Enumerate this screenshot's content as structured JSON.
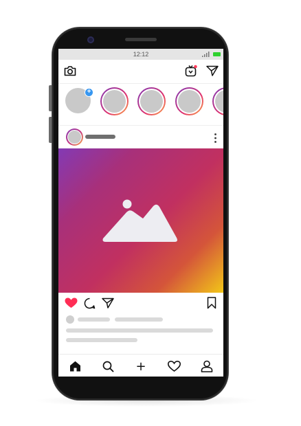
{
  "status_bar": {
    "time": "12:12",
    "battery_color": "#2fd12f"
  },
  "top_bar": {
    "left_icon": "camera-icon",
    "right_icons": [
      "igtv-icon",
      "direct-message-icon"
    ],
    "notification_color": "#ff3b5c"
  },
  "stories": {
    "own_story_add_glyph": "+",
    "add_badge_color": "#3897f0",
    "ring_gradient": [
      "#833ab4",
      "#c13584",
      "#e1306c",
      "#fcb045"
    ],
    "story_count_visible": 4
  },
  "post": {
    "header_more_icon": "more-vertical-icon",
    "image_placeholder_icon": "image-mountain-icon",
    "image_gradient": [
      "#833ab4",
      "#c13060",
      "#d4553a",
      "#f2c618"
    ],
    "actions": [
      "heart-filled-icon",
      "comment-icon",
      "share-icon",
      "bookmark-icon"
    ],
    "liked": true,
    "like_color": "#ff2d55"
  },
  "bottom_nav": {
    "items": [
      "home-icon",
      "search-icon",
      "add-post-icon",
      "activity-heart-icon",
      "profile-icon"
    ],
    "add_glyph": "+",
    "active": "home-icon"
  }
}
